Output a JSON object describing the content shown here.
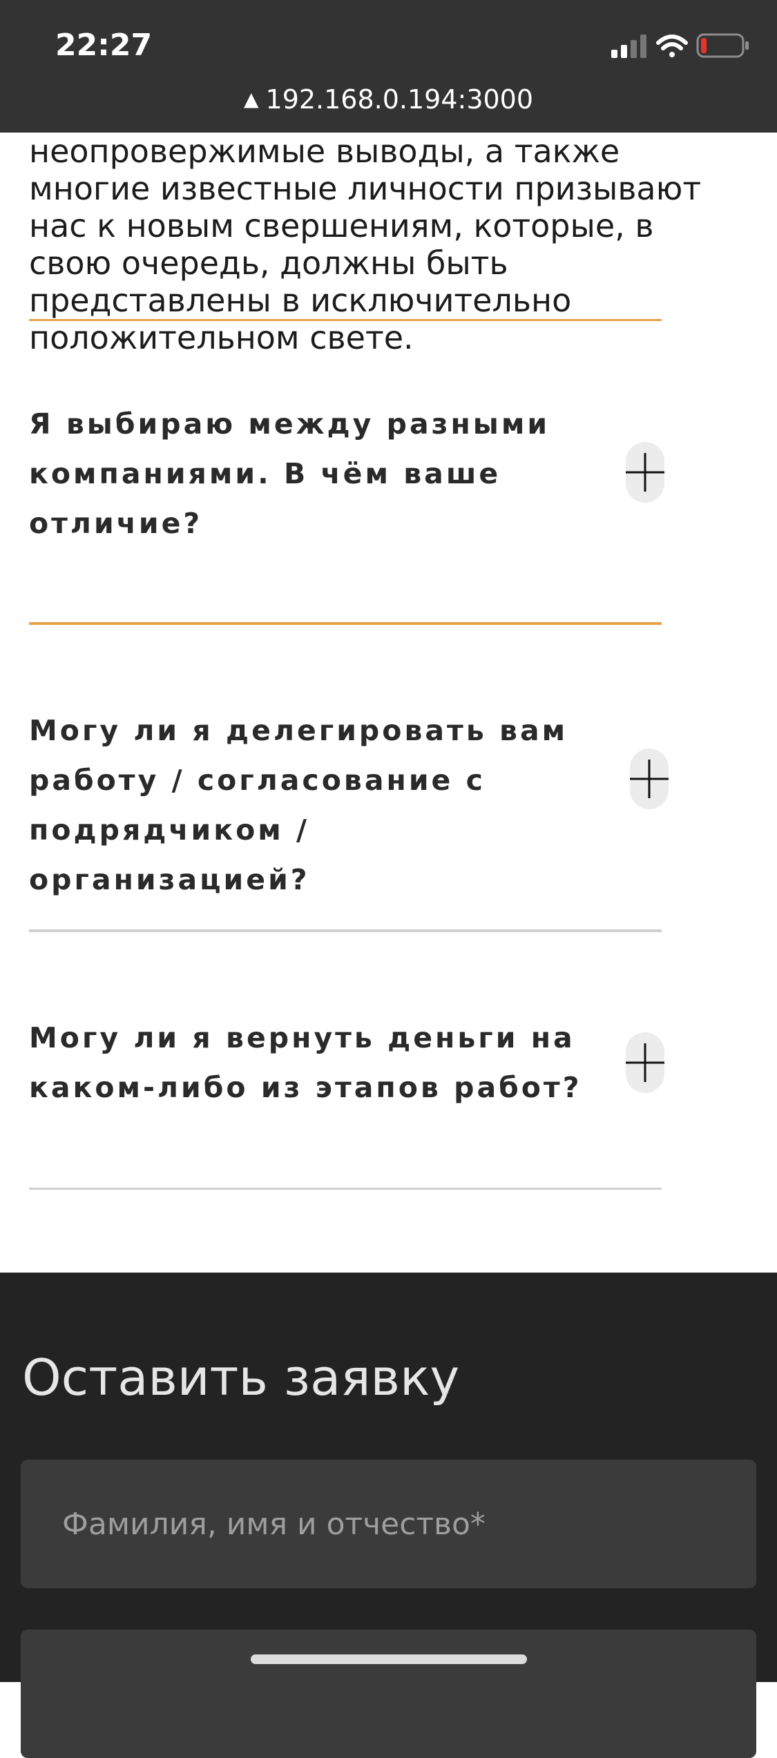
{
  "status_bar": {
    "time": "22:27",
    "icons": [
      "cellular-signal-icon",
      "wifi-icon",
      "battery-low-icon"
    ],
    "battery_color": "#e5352b"
  },
  "url_bar": {
    "warning_icon": "warning-icon",
    "url": "192.168.0.194:3000"
  },
  "intro_text": "неопровержимые выводы, а также многие известные личности призывают нас к новым свершениям, которые, в свою очередь, должны быть представлены в исключительно положительном свете.",
  "faq": [
    {
      "question": "Я выбираю между разными компаниями. В чём ваше отличие?",
      "toggle_icon": "plus-icon"
    },
    {
      "question": "Могу ли я делегировать вам работу / согласование с подрядчиком / организацией?",
      "toggle_icon": "plus-icon"
    },
    {
      "question": "Могу ли я вернуть деньги на каком-либо из этапов работ?",
      "toggle_icon": "plus-icon"
    }
  ],
  "form": {
    "title": "Оставить заявку",
    "name_placeholder": "Фамилия, имя и отчество*"
  },
  "colors": {
    "accent": "#e9a24a",
    "dark_bg": "#232323",
    "field_bg": "#3b3b3b"
  }
}
